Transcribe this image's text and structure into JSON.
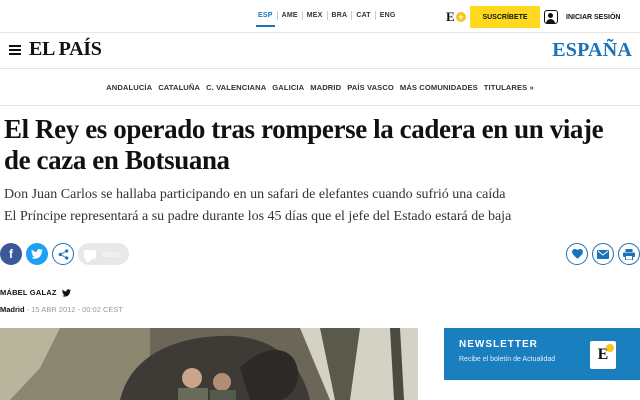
{
  "editions": [
    "ESP",
    "AME",
    "MEX",
    "BRA",
    "CAT",
    "ENG"
  ],
  "header": {
    "subscribe_label": "SUSCRÍBETE",
    "login_label": "INICIAR SESIÓN",
    "logo": "EL PAÍS",
    "section": "ESPAÑA"
  },
  "regions": [
    "ANDALUCÍA",
    "CATALUÑA",
    "C. VALENCIANA",
    "GALICIA",
    "MADRID",
    "PAÍS VASCO",
    "MÁS COMUNIDADES",
    "TITULARES »"
  ],
  "article": {
    "headline": "El Rey es operado tras romperse la cadera en un viaje de caza en Botsuana",
    "subtitle_1": "Don Juan Carlos se hallaba participando en un safari de elefantes cuando sufrió una caída",
    "subtitle_2": "El Príncipe representará a su padre durante los 45 días que el jefe del Estado estará de baja",
    "comment_count": "6970",
    "author": "MÁBEL GALAZ",
    "location": "Madrid",
    "date": " - 15 ABR 2012 - 00:02 CEST"
  },
  "newsletter": {
    "title": "NEWSLETTER",
    "text": "Recibe el boletín de Actualidad"
  },
  "colors": {
    "brand_blue": "#1a73b8",
    "subscribe_yellow": "#ffd91e",
    "newsletter_blue": "#1a7fbf"
  }
}
